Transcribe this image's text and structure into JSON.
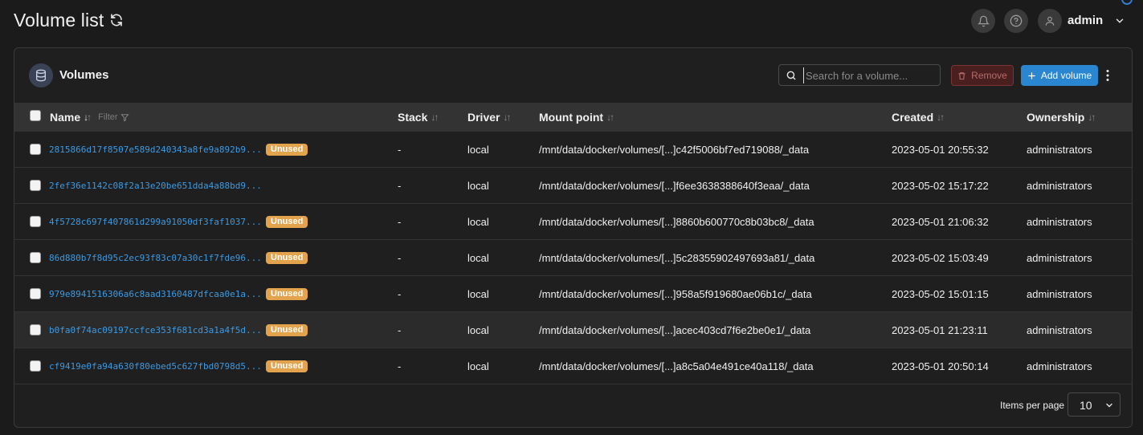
{
  "header": {
    "title": "Volume list",
    "user": "admin",
    "icons": [
      "refresh-icon",
      "bell-icon",
      "help-icon",
      "user-icon",
      "chevron-down-icon"
    ]
  },
  "panel": {
    "title": "Volumes",
    "search_placeholder": "Search for a volume...",
    "remove_label": "Remove",
    "add_label": "Add volume"
  },
  "table": {
    "columns": {
      "name": "Name",
      "filter": "Filter",
      "stack": "Stack",
      "driver": "Driver",
      "mount": "Mount point",
      "created": "Created",
      "ownership": "Ownership"
    },
    "rows": [
      {
        "name": "2815866d17f8507e589d240343a8fe9a892b9...",
        "badge": "Unused",
        "stack": "-",
        "driver": "local",
        "mount": "/mnt/data/docker/volumes/[...]c42f5006bf7ed719088/_data",
        "created": "2023-05-01 20:55:32",
        "ownership": "administrators"
      },
      {
        "name": "2fef36e1142c08f2a13e20be651dda4a88bd9...",
        "badge": "",
        "stack": "-",
        "driver": "local",
        "mount": "/mnt/data/docker/volumes/[...]f6ee3638388640f3eaa/_data",
        "created": "2023-05-02 15:17:22",
        "ownership": "administrators"
      },
      {
        "name": "4f5728c697f407861d299a91050df3faf1037...",
        "badge": "Unused",
        "stack": "-",
        "driver": "local",
        "mount": "/mnt/data/docker/volumes/[...]8860b600770c8b03bc8/_data",
        "created": "2023-05-01 21:06:32",
        "ownership": "administrators"
      },
      {
        "name": "86d880b7f8d95c2ec93f83c07a30c1f7fde96...",
        "badge": "Unused",
        "stack": "-",
        "driver": "local",
        "mount": "/mnt/data/docker/volumes/[...]5c28355902497693a81/_data",
        "created": "2023-05-02 15:03:49",
        "ownership": "administrators"
      },
      {
        "name": "979e8941516306a6c8aad3160487dfcaa0e1a...",
        "badge": "Unused",
        "stack": "-",
        "driver": "local",
        "mount": "/mnt/data/docker/volumes/[...]958a5f919680ae06b1c/_data",
        "created": "2023-05-02 15:01:15",
        "ownership": "administrators"
      },
      {
        "name": "b0fa0f74ac09197ccfce353f681cd3a1a4f5d...",
        "badge": "Unused",
        "stack": "-",
        "driver": "local",
        "mount": "/mnt/data/docker/volumes/[...]acec403cd7f6e2be0e1/_data",
        "created": "2023-05-01 21:23:11",
        "ownership": "administrators"
      },
      {
        "name": "cf9419e0fa94a630f80ebed5c627fbd0798d5...",
        "badge": "Unused",
        "stack": "-",
        "driver": "local",
        "mount": "/mnt/data/docker/volumes/[...]a8c5a04e491ce40a118/_data",
        "created": "2023-05-01 20:50:14",
        "ownership": "administrators"
      }
    ]
  },
  "footer": {
    "items_per_page_label": "Items per page",
    "items_per_page_value": "10"
  },
  "colors": {
    "link": "#3b9ae4",
    "badge": "#e3a24c",
    "primary": "#2a86d0",
    "danger": "#4a1f1f"
  }
}
